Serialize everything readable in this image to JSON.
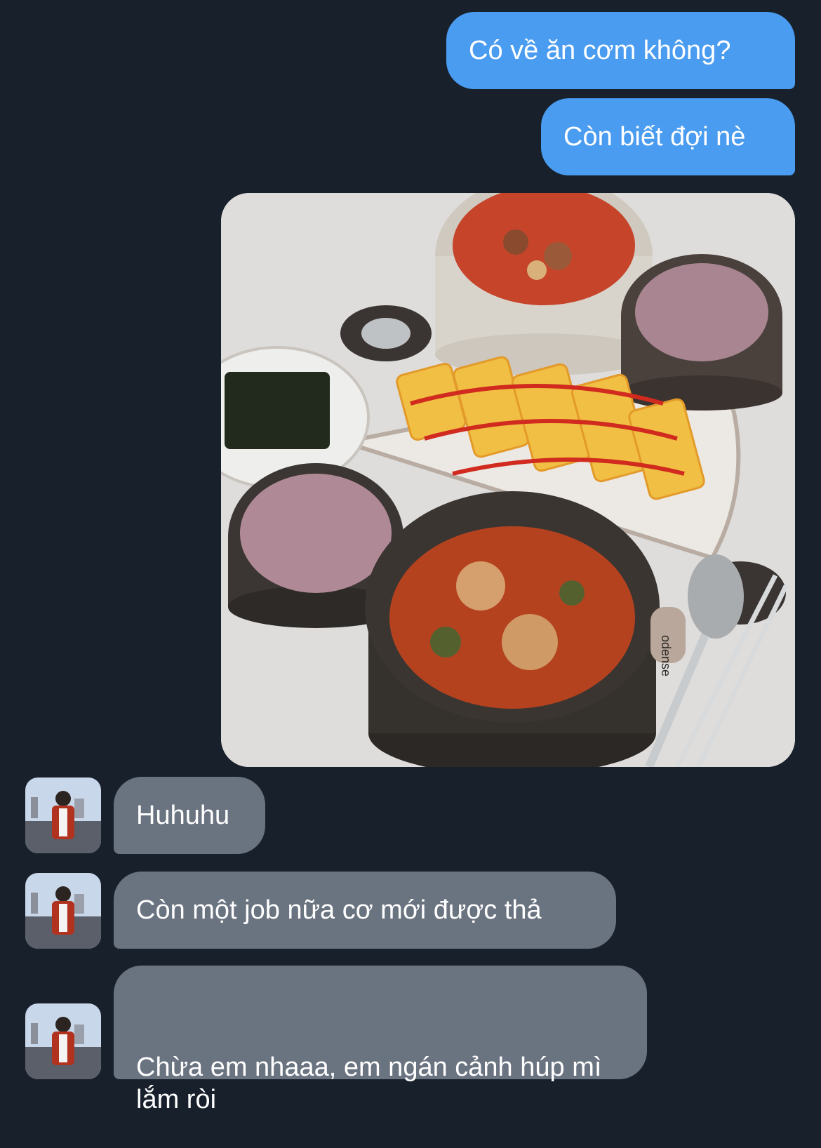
{
  "messages": [
    {
      "sender": "me",
      "text": "Có về ăn cơm không?"
    },
    {
      "sender": "me",
      "text": "Còn biết đợi nè"
    },
    {
      "sender": "me",
      "type": "photo"
    },
    {
      "sender": "them",
      "text": "Huhuhu"
    },
    {
      "sender": "them",
      "text": "Còn một job nữa cơ mới được thả"
    },
    {
      "sender": "them",
      "text": "Chừa em nhaaa, em ngán cảnh húp mì lắm ròi"
    }
  ],
  "photo": {
    "bowl_brand": "odense"
  },
  "colors": {
    "background": "#18202b",
    "outgoing_bubble": "#4a9cf0",
    "incoming_bubble": "#6a7380",
    "text": "#ffffff"
  }
}
